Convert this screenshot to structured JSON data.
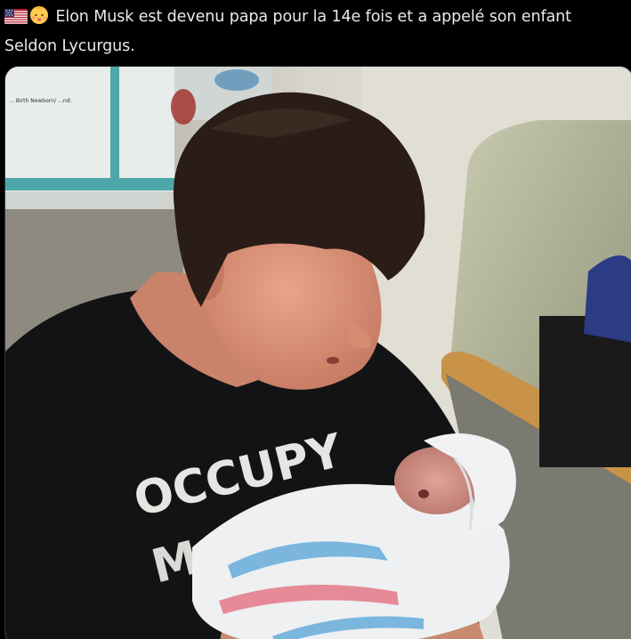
{
  "post": {
    "flag_icon": "us-flag-emoji",
    "baby_icon": "baby-emoji",
    "text_line1": "Elon Musk est devenu papa pour la 14e fois et a appelé son enfant",
    "text_line2": "Seldon Lycurgus."
  },
  "media": {
    "sign_text": "… Birth Newborn/ …nd:",
    "shirt_word1": "OCCUPY",
    "shirt_word2": "MARS"
  },
  "colors": {
    "background": "#000000",
    "text": "#e7e9ea",
    "card_border": "#2f3336"
  }
}
